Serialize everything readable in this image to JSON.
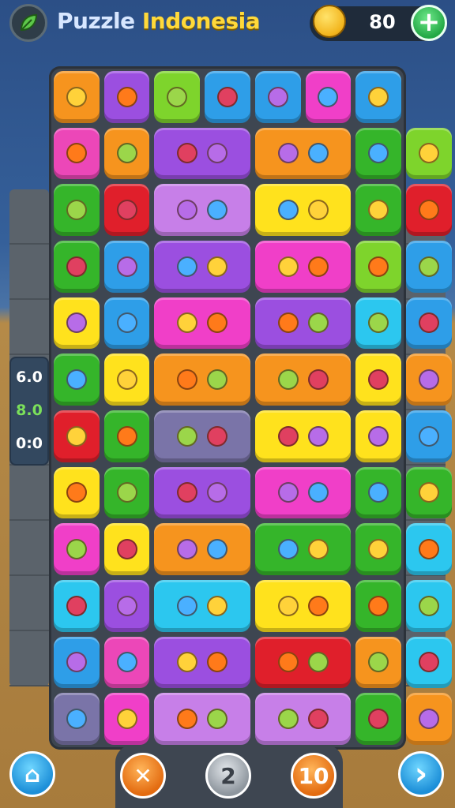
{
  "header": {
    "title_part1": "Puzzle",
    "title_part2": "Indonesia",
    "coins": "80",
    "add_label": "+"
  },
  "score_panel": {
    "line1": "6.0",
    "line2": "8.0",
    "line3": "0:0"
  },
  "bottom": {
    "home_label": "⌂",
    "cancel_label": "✕",
    "count_label": "2",
    "moves_label": "10",
    "next_label": "›"
  },
  "colors": {
    "orange": "#f6941e",
    "purple": "#9b4fe0",
    "green": "#35b52a",
    "blue": "#2e9ee8",
    "pink": "#f03fc8",
    "yellow": "#ffe21d",
    "red": "#e01f2b",
    "lightgreen": "#7ed42c",
    "cyan": "#2cc7ef",
    "lavender": "#c77fe8",
    "gray": "#7a74a8",
    "magenta": "#ec47b8"
  },
  "board": {
    "rows": [
      [
        {
          "c": "orange",
          "i": "lemon-icon"
        },
        {
          "c": "purple",
          "i": "plum-icon"
        },
        {
          "c": "lightgreen",
          "i": "basket-icon"
        },
        {
          "c": "blue",
          "i": "jar-icon"
        },
        {
          "c": "blue",
          "i": "jar-icon"
        },
        {
          "c": "pink",
          "i": "face-icon"
        },
        {
          "c": "blue",
          "i": "orange-fruit-icon"
        }
      ],
      [
        {
          "c": "magenta",
          "i": "candy-icon"
        },
        {
          "c": "orange",
          "i": "lemon-icon"
        },
        {
          "c": "purple",
          "i": "flower-icon",
          "w": 2
        },
        {
          "c": "orange",
          "i": "leaf-icon",
          "w": 2
        },
        {
          "c": "green",
          "i": "orange-fruit-icon"
        },
        {
          "c": "lightgreen",
          "i": "lemon-icon"
        }
      ],
      [
        {
          "c": "green",
          "i": "kettlebell-icon"
        },
        {
          "c": "red",
          "i": "eraser-icon"
        },
        {
          "c": "lavender",
          "i": "star-icon",
          "w": 2
        },
        {
          "c": "yellow",
          "i": "leaf-icon",
          "w": 2
        },
        {
          "c": "green",
          "i": "badge-icon"
        },
        {
          "c": "red",
          "i": "berry-icon"
        }
      ],
      [
        {
          "c": "green",
          "i": "cube-icon"
        },
        {
          "c": "blue",
          "i": "plum-icon"
        },
        {
          "c": "purple",
          "i": "star-icon",
          "w": 2
        },
        {
          "c": "pink",
          "i": "banana-icon",
          "w": 2
        },
        {
          "c": "lightgreen",
          "i": "face-icon"
        },
        {
          "c": "blue",
          "i": "orange-fruit-icon"
        }
      ],
      [
        {
          "c": "yellow",
          "i": "candy-icon"
        },
        {
          "c": "blue",
          "i": "lemon-icon"
        },
        {
          "c": "pink",
          "i": "leaf-icon",
          "w": 2
        },
        {
          "c": "purple",
          "i": "star-icon",
          "w": 2
        },
        {
          "c": "cyan",
          "i": "face-icon"
        },
        {
          "c": "blue",
          "i": "cake-icon"
        }
      ],
      [
        {
          "c": "green",
          "i": "face-icon"
        },
        {
          "c": "yellow",
          "i": "orange-fruit-icon"
        },
        {
          "c": "orange",
          "i": "leaf-icon",
          "w": 2
        },
        {
          "c": "orange",
          "i": "leaf-icon",
          "w": 2
        },
        {
          "c": "yellow",
          "i": "badge-icon"
        },
        {
          "c": "orange",
          "i": "berry-icon"
        }
      ],
      [
        {
          "c": "red",
          "i": "potion-icon"
        },
        {
          "c": "green",
          "i": "face-icon"
        },
        {
          "c": "gray",
          "i": "plum-icon",
          "w": 2
        },
        {
          "c": "yellow",
          "i": "cherry-icon",
          "w": 2
        },
        {
          "c": "yellow",
          "i": "eggplant-icon"
        },
        {
          "c": "blue",
          "i": "heart-icon"
        }
      ],
      [
        {
          "c": "yellow",
          "i": "face-icon"
        },
        {
          "c": "green",
          "i": "plum-icon"
        },
        {
          "c": "purple",
          "i": "star-icon",
          "w": 2
        },
        {
          "c": "pink",
          "i": "star-icon",
          "w": 2
        },
        {
          "c": "green",
          "i": "face-icon"
        },
        {
          "c": "green",
          "i": "face-icon"
        }
      ],
      [
        {
          "c": "pink",
          "i": "cake-icon"
        },
        {
          "c": "yellow",
          "i": "lemon-icon"
        },
        {
          "c": "orange",
          "i": "apple-icon",
          "w": 2
        },
        {
          "c": "green",
          "i": "pear-icon",
          "w": 2
        },
        {
          "c": "green",
          "i": "badge-icon"
        },
        {
          "c": "cyan",
          "i": "berry-icon"
        }
      ],
      [
        {
          "c": "cyan",
          "i": "lollipop-icon"
        },
        {
          "c": "purple",
          "i": "eggplant-icon"
        },
        {
          "c": "cyan",
          "i": "star-icon",
          "w": 2
        },
        {
          "c": "yellow",
          "i": "strawberry-icon",
          "w": 2
        },
        {
          "c": "green",
          "i": "lollipop-icon"
        },
        {
          "c": "cyan",
          "i": "cake-icon"
        }
      ],
      [
        {
          "c": "blue",
          "i": "lemon-icon"
        },
        {
          "c": "magenta",
          "i": "orange-fruit-icon"
        },
        {
          "c": "purple",
          "i": "star-icon",
          "w": 2
        },
        {
          "c": "red",
          "i": "carrot-icon",
          "w": 2
        },
        {
          "c": "orange",
          "i": "face-icon"
        },
        {
          "c": "cyan",
          "i": "lemon-icon"
        }
      ],
      [
        {
          "c": "gray",
          "i": "helmet-icon"
        },
        {
          "c": "pink",
          "i": "lemon-icon"
        },
        {
          "c": "lavender",
          "i": "grape-icon",
          "w": 2
        },
        {
          "c": "lavender",
          "i": "star-icon",
          "w": 2
        },
        {
          "c": "green",
          "i": "eggplant-icon"
        },
        {
          "c": "orange",
          "i": "face-icon"
        }
      ]
    ]
  }
}
